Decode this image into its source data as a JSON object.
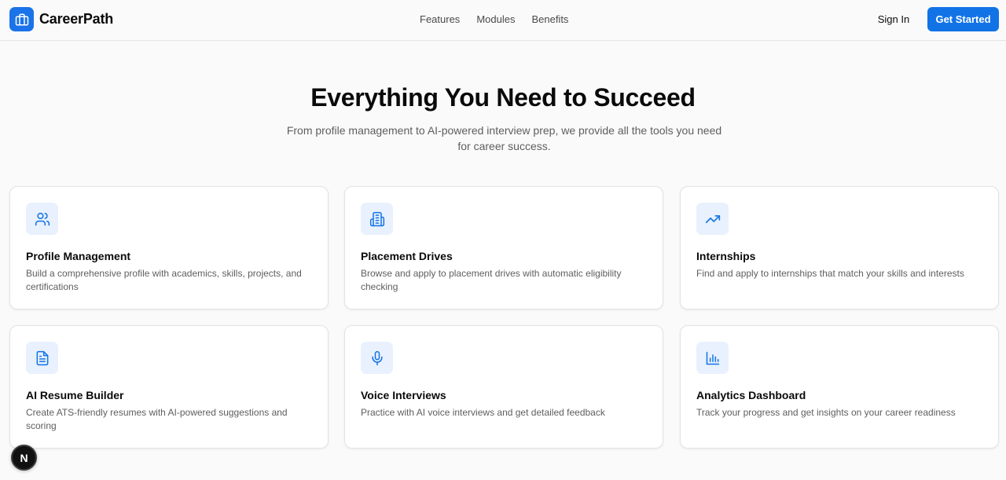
{
  "header": {
    "brand": "CareerPath",
    "brand_icon": "briefcase-icon",
    "nav": [
      {
        "label": "Features"
      },
      {
        "label": "Modules"
      },
      {
        "label": "Benefits"
      }
    ],
    "sign_in_label": "Sign In",
    "cta_label": "Get Started"
  },
  "hero": {
    "title": "Everything You Need to Succeed",
    "subtitle": "From profile management to AI-powered interview prep, we provide all the tools you need for career success."
  },
  "features": [
    {
      "icon": "users-icon",
      "title": "Profile Management",
      "description": "Build a comprehensive profile with academics, skills, projects, and certifications"
    },
    {
      "icon": "building-icon",
      "title": "Placement Drives",
      "description": "Browse and apply to placement drives with automatic eligibility checking"
    },
    {
      "icon": "trending-up-icon",
      "title": "Internships",
      "description": "Find and apply to internships that match your skills and interests"
    },
    {
      "icon": "file-text-icon",
      "title": "AI Resume Builder",
      "description": "Create ATS-friendly resumes with AI-powered suggestions and scoring"
    },
    {
      "icon": "mic-icon",
      "title": "Voice Interviews",
      "description": "Practice with AI voice interviews and get detailed feedback"
    },
    {
      "icon": "bar-chart-icon",
      "title": "Analytics Dashboard",
      "description": "Track your progress and get insights on your career readiness"
    }
  ],
  "dev_badge": {
    "letter": "N",
    "icon": "nextjs-logo-icon"
  },
  "colors": {
    "accent": "#1273e6",
    "icon_bg": "#e8f1fd",
    "background": "#fafafa"
  }
}
